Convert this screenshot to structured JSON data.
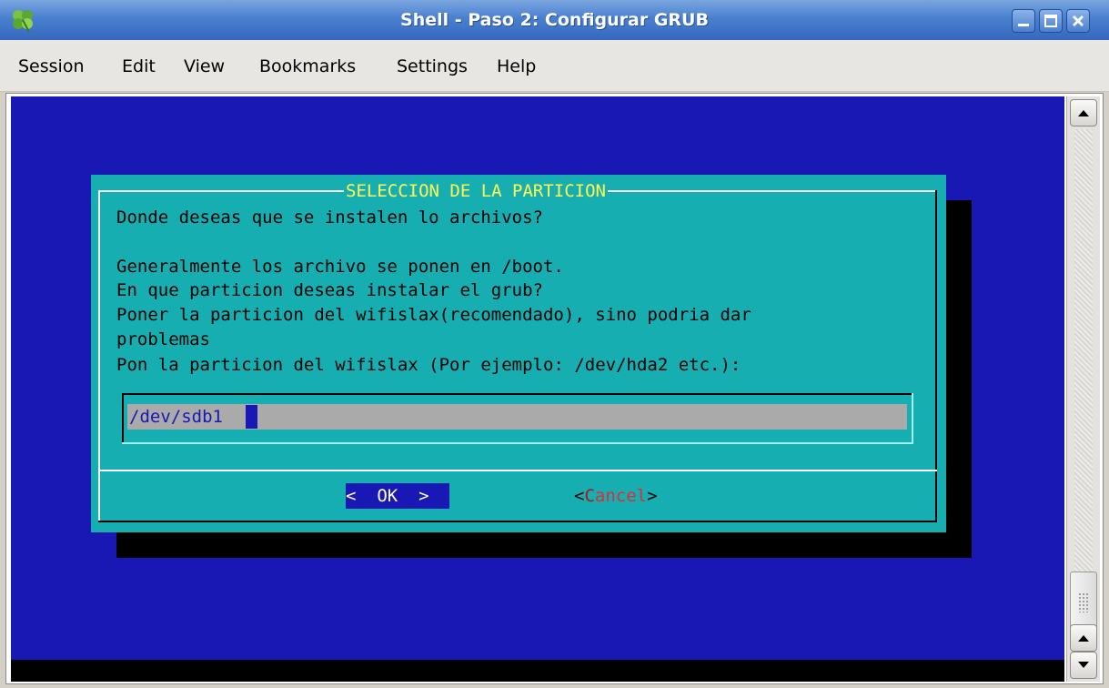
{
  "window": {
    "title": "Shell - Paso 2: Configurar GRUB"
  },
  "menubar": [
    "Session",
    "Edit",
    "View",
    "Bookmarks",
    "Settings",
    "Help"
  ],
  "dialog": {
    "title": "SELECCION DE LA PARTICION",
    "lines": [
      "Donde deseas que se instalen lo archivos?",
      "",
      "Generalmente los archivo se ponen en /boot.",
      "En que particion deseas instalar el grub?",
      "Poner la particion del wifislax(recomendado), sino podria dar",
      "problemas",
      "Pon la particion del wifislax (Por ejemplo: /dev/hda2 etc.):"
    ],
    "input_value": "/dev/sdb1",
    "ok_label": "<  OK  >",
    "cancel_open": "<",
    "cancel_hotkey": "C",
    "cancel_rest": "ancel",
    "cancel_close": ">"
  },
  "icons": {
    "app": "clover-icon",
    "minimize": "minimize-icon",
    "maximize": "maximize-icon",
    "close": "close-icon",
    "scroll_up": "arrow-up-icon",
    "scroll_down": "arrow-down-icon"
  },
  "colors": {
    "terminal_bg": "#1a18b4",
    "dialog_bg": "#16aeb0",
    "title_yellow": "#ffff54",
    "field_gray": "#aaaaaa"
  }
}
